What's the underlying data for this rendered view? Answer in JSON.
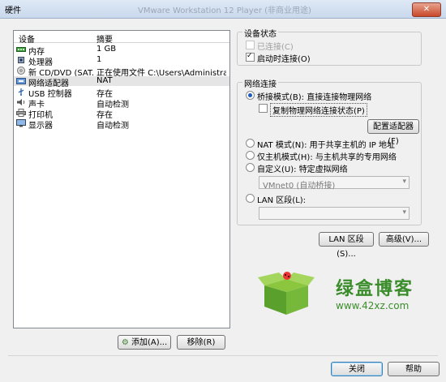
{
  "window": {
    "title": "硬件",
    "ghost_title": "VMware Workstation 12 Player (非商业用途)",
    "close_symbol": "✕"
  },
  "device_list": {
    "headers": {
      "device": "设备",
      "summary": "摘要"
    },
    "rows": [
      {
        "icon": "memory-icon",
        "device": "内存",
        "summary": "1 GB"
      },
      {
        "icon": "processor-icon",
        "device": "处理器",
        "summary": "1"
      },
      {
        "icon": "cd-dvd-icon",
        "device": "新 CD/DVD (SAT...",
        "summary": "正在使用文件 C:\\Users\\Administrato..."
      },
      {
        "icon": "network-adapter-icon",
        "device": "网络适配器",
        "summary": "NAT"
      },
      {
        "icon": "usb-icon",
        "device": "USB 控制器",
        "summary": "存在"
      },
      {
        "icon": "sound-card-icon",
        "device": "声卡",
        "summary": "自动检测"
      },
      {
        "icon": "printer-icon",
        "device": "打印机",
        "summary": "存在"
      },
      {
        "icon": "display-icon",
        "device": "显示器",
        "summary": "自动检测"
      }
    ],
    "selected_index": 3
  },
  "buttons": {
    "add": "添加(A)...",
    "remove": "移除(R)",
    "close": "关闭",
    "help": "帮助"
  },
  "device_status": {
    "title": "设备状态",
    "connected": {
      "label": "已连接(C)",
      "checked": false,
      "enabled": false
    },
    "connect_at_power_on": {
      "label": "启动时连接(O)",
      "checked": true
    }
  },
  "network_connection": {
    "title": "网络连接",
    "bridged": {
      "label": "桥接模式(B): 直接连接物理网络",
      "checked": true
    },
    "replicate": {
      "label": "复制物理网络连接状态(P)",
      "checked": false
    },
    "configure_adapters": "配置适配器(F)",
    "nat": {
      "label": "NAT 模式(N): 用于共享主机的 IP 地址",
      "checked": false
    },
    "host_only": {
      "label": "仅主机模式(H): 与主机共享的专用网络",
      "checked": false
    },
    "custom": {
      "label": "自定义(U): 特定虚拟网络",
      "checked": false
    },
    "custom_value": "VMnet0 (自动桥接)",
    "lan_segment": {
      "label": "LAN 区段(L):",
      "checked": false
    },
    "lan_segment_value": ""
  },
  "lower_buttons": {
    "lan_segments": "LAN 区段(S)...",
    "advanced": "高级(V)..."
  },
  "watermark": {
    "text": "绿盒博客",
    "url": "www.42xz.com"
  }
}
